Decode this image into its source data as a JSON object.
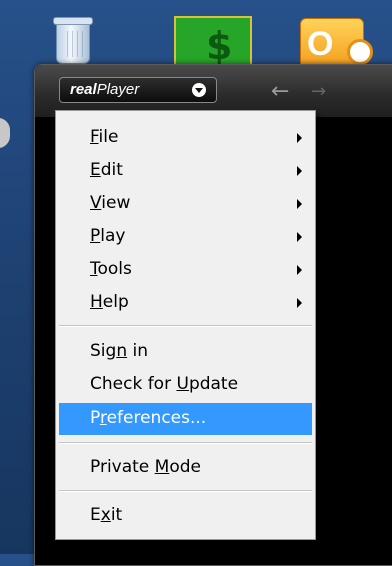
{
  "desktop": {
    "icons": [
      "recycle-bin-icon",
      "green-dollar-app-icon",
      "outlook-icon"
    ],
    "colors": {
      "background": "#1e4274"
    }
  },
  "player": {
    "logo": {
      "text_prefix": "real",
      "text_suffix": "Player"
    },
    "nav": {
      "back": "←",
      "forward": "→"
    }
  },
  "menu": {
    "items": [
      {
        "pre": "",
        "u": "F",
        "post": "ile",
        "submenu": true
      },
      {
        "pre": "",
        "u": "E",
        "post": "dit",
        "submenu": true
      },
      {
        "pre": "",
        "u": "V",
        "post": "iew",
        "submenu": true
      },
      {
        "pre": "",
        "u": "P",
        "post": "lay",
        "submenu": true
      },
      {
        "pre": "",
        "u": "T",
        "post": "ools",
        "submenu": true
      },
      {
        "pre": "",
        "u": "H",
        "post": "elp",
        "submenu": true
      },
      {
        "pre": "Sig",
        "u": "n",
        "post": " in",
        "submenu": false
      },
      {
        "pre": "Check for ",
        "u": "U",
        "post": "pdate",
        "submenu": false
      },
      {
        "pre": "P",
        "u": "r",
        "post": "eferences...",
        "submenu": false,
        "selected": true
      },
      {
        "pre": "Private ",
        "u": "M",
        "post": "ode",
        "submenu": false
      },
      {
        "pre": "E",
        "u": "x",
        "post": "it",
        "submenu": false
      }
    ],
    "colors": {
      "highlight": "#3399ff",
      "background": "#f0f0f0"
    }
  }
}
